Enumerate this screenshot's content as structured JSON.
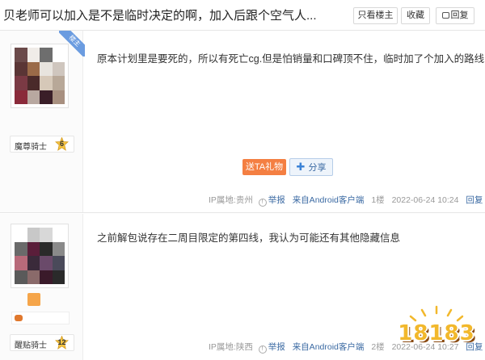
{
  "header": {
    "title": "贝老师可以加入是不是临时决定的啊，加入后跟个空气人...",
    "only_op_label": "只看楼主",
    "favorite_label": "收藏",
    "reply_label": "回复"
  },
  "posts": [
    {
      "op_badge": "楼主",
      "rank_name": "魔尊骑士",
      "rank_level": "6",
      "content": "原本计划里是要死的，所以有死亡cg.但是怕销量和口碑顶不住，临时加了个加入的路线",
      "gift_label": "送TA礼物",
      "share_label": "分享",
      "ip": "IP属地:贵州",
      "report_label": "举报",
      "client": "来自Android客户端",
      "floor": "1楼",
      "time": "2022-06-24 10:24",
      "reply_label": "回复"
    },
    {
      "rank_name": "醒贴骑士",
      "rank_level": "12",
      "content": "之前解包说存在二周目限定的第四线，我认为可能还有其他隐藏信息",
      "ip": "IP属地:陕西",
      "report_label": "举报",
      "client": "来自Android客户端",
      "floor": "2楼",
      "time": "2022-06-24 10:27",
      "reply_label": "回复"
    }
  ],
  "watermark": {
    "text": "18183"
  },
  "colors": {
    "gift": "#f47f42",
    "link": "#3b6aa3",
    "op_badge": "#6b9ce0",
    "level_badge": "#f5c542"
  }
}
